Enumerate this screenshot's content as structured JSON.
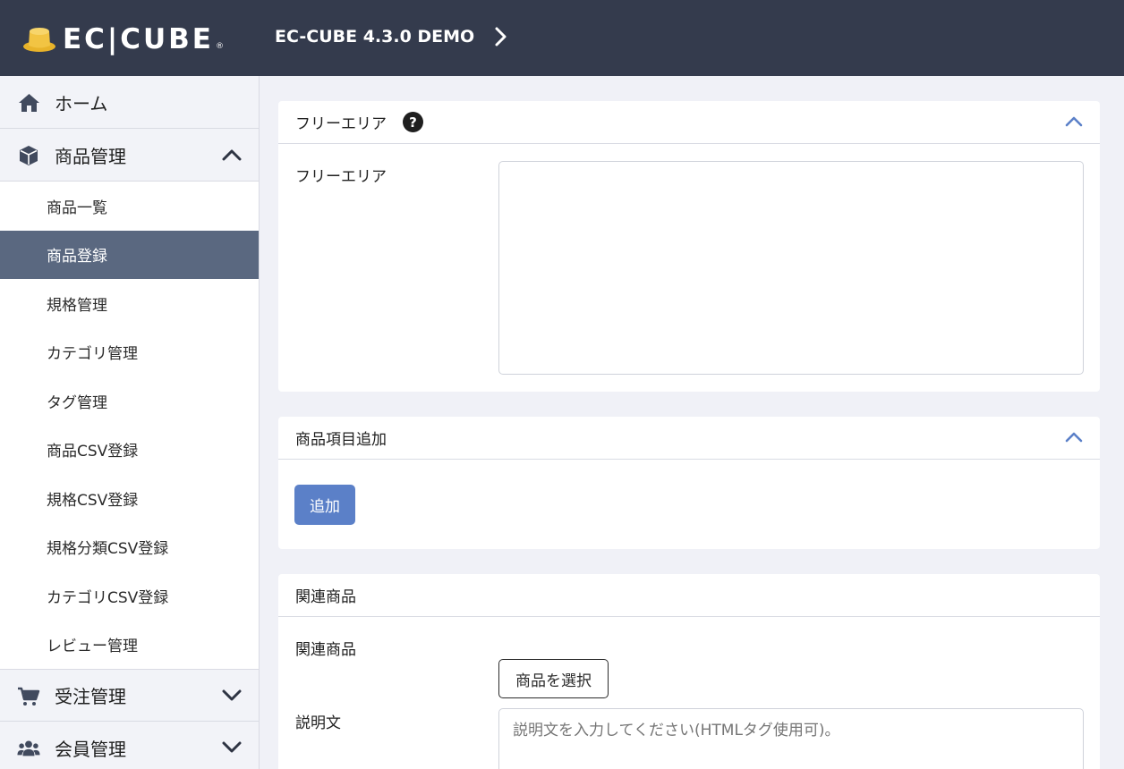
{
  "header": {
    "logo_text": "EC|CUBE",
    "logo_mark": "®",
    "shop_name": "EC-CUBE 4.3.0 DEMO"
  },
  "sidebar": {
    "home": {
      "label": "ホーム",
      "icon": "home-icon"
    },
    "product": {
      "label": "商品管理",
      "icon": "box-icon",
      "expanded": true,
      "items": [
        {
          "label": "商品一覧",
          "active": false
        },
        {
          "label": "商品登録",
          "active": true
        },
        {
          "label": "規格管理",
          "active": false
        },
        {
          "label": "カテゴリ管理",
          "active": false
        },
        {
          "label": "タグ管理",
          "active": false
        },
        {
          "label": "商品CSV登録",
          "active": false
        },
        {
          "label": "規格CSV登録",
          "active": false
        },
        {
          "label": "規格分類CSV登録",
          "active": false
        },
        {
          "label": "カテゴリCSV登録",
          "active": false
        },
        {
          "label": "レビュー管理",
          "active": false
        }
      ]
    },
    "order": {
      "label": "受注管理",
      "icon": "cart-icon"
    },
    "customer": {
      "label": "会員管理",
      "icon": "users-icon"
    }
  },
  "free_area": {
    "title": "フリーエリア",
    "help": "?",
    "field_label": "フリーエリア",
    "value": ""
  },
  "product_items": {
    "title": "商品項目追加",
    "add_label": "追加"
  },
  "related": {
    "title": "関連商品",
    "field_label": "関連商品",
    "select_label": "商品を選択",
    "desc_label": "説明文",
    "desc_placeholder": "説明文を入力してください(HTMLタグ使用可)。"
  },
  "colors": {
    "header_bg": "#343B4D",
    "active_nav": "#5A6880",
    "primary": "#5B80C8",
    "page_bg": "#F0F1F7"
  }
}
